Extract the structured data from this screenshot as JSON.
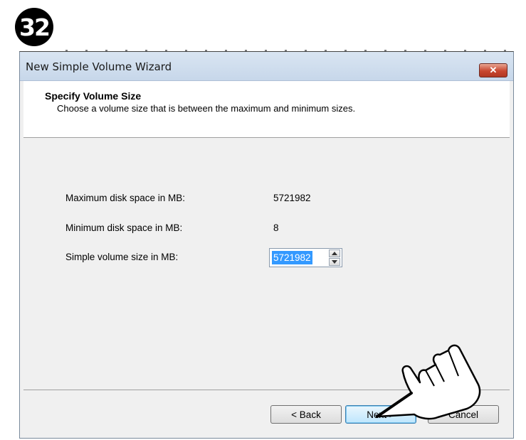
{
  "step_number": "32",
  "window": {
    "title": "New Simple Volume Wizard",
    "close_glyph": "✕"
  },
  "header": {
    "title": "Specify Volume Size",
    "subtitle": "Choose a volume size that is between the maximum and minimum sizes."
  },
  "fields": {
    "max_label": "Maximum disk space in MB:",
    "max_value": "5721982",
    "min_label": "Minimum disk space in MB:",
    "min_value": "8",
    "size_label": "Simple volume size in MB:",
    "size_value": "5721982"
  },
  "buttons": {
    "back": "< Back",
    "next": "Next >",
    "cancel": "Cancel"
  },
  "icons": {
    "spin_up": "up-arrow-icon",
    "spin_down": "down-arrow-icon",
    "pointer": "pointing-hand-icon"
  },
  "colors": {
    "selection": "#3399ff",
    "close_button": "#c8462f",
    "next_button": "#bee6fd"
  }
}
